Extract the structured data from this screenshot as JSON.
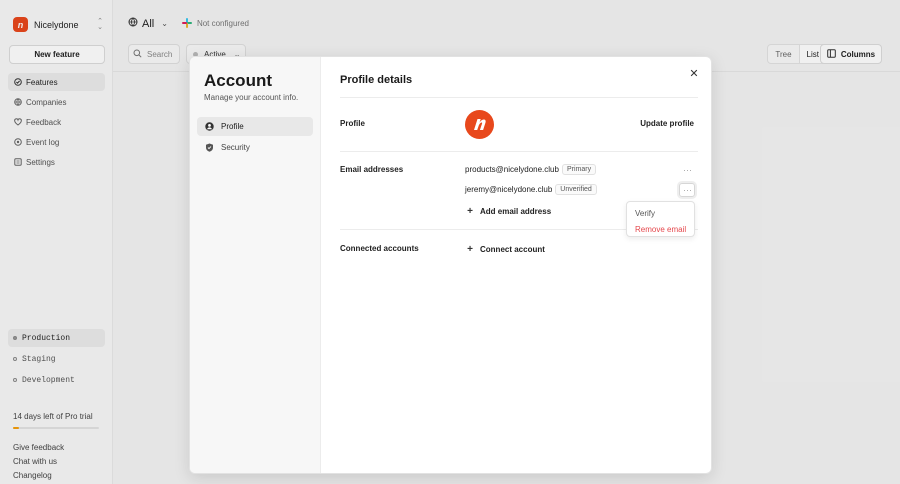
{
  "workspace": {
    "name": "Nicelydone",
    "logo_letter": "n"
  },
  "sidebar": {
    "new_button": "New feature",
    "items": [
      {
        "label": "Features",
        "icon": "features-icon",
        "active": true
      },
      {
        "label": "Companies",
        "icon": "companies-icon"
      },
      {
        "label": "Feedback",
        "icon": "feedback-icon"
      },
      {
        "label": "Event log",
        "icon": "event-log-icon"
      },
      {
        "label": "Settings",
        "icon": "settings-icon"
      }
    ],
    "environments": [
      {
        "label": "Production",
        "active": true
      },
      {
        "label": "Staging"
      },
      {
        "label": "Development"
      }
    ],
    "trial": {
      "text": "14 days left of Pro trial",
      "progress": 0.07
    },
    "footer_links": [
      "Give feedback",
      "Chat with us",
      "Changelog"
    ]
  },
  "header": {
    "filter_label": "All",
    "status_text": "Not configured"
  },
  "toolbar": {
    "search_placeholder": "Search",
    "status_filter": "Active",
    "view_options": [
      "Tree",
      "List"
    ],
    "selected_view": "List",
    "columns_label": "Columns"
  },
  "modal": {
    "title": "Account",
    "subtitle": "Manage your account info.",
    "nav": [
      {
        "label": "Profile",
        "icon": "user-icon",
        "active": true
      },
      {
        "label": "Security",
        "icon": "shield-icon"
      }
    ],
    "section_title": "Profile details",
    "profile_label": "Profile",
    "update_profile": "Update profile",
    "email_label": "Email addresses",
    "emails": [
      {
        "address": "products@nicelydone.club",
        "badge": "Primary"
      },
      {
        "address": "jeremy@nicelydone.club",
        "badge": "Unverified"
      }
    ],
    "add_email": "Add email address",
    "connected_label": "Connected accounts",
    "connect_account": "Connect account",
    "email_menu": {
      "verify": "Verify",
      "remove": "Remove email"
    }
  },
  "colors": {
    "brand": "#e8481c",
    "danger": "#e5484d",
    "trial": "#f59e0b"
  }
}
